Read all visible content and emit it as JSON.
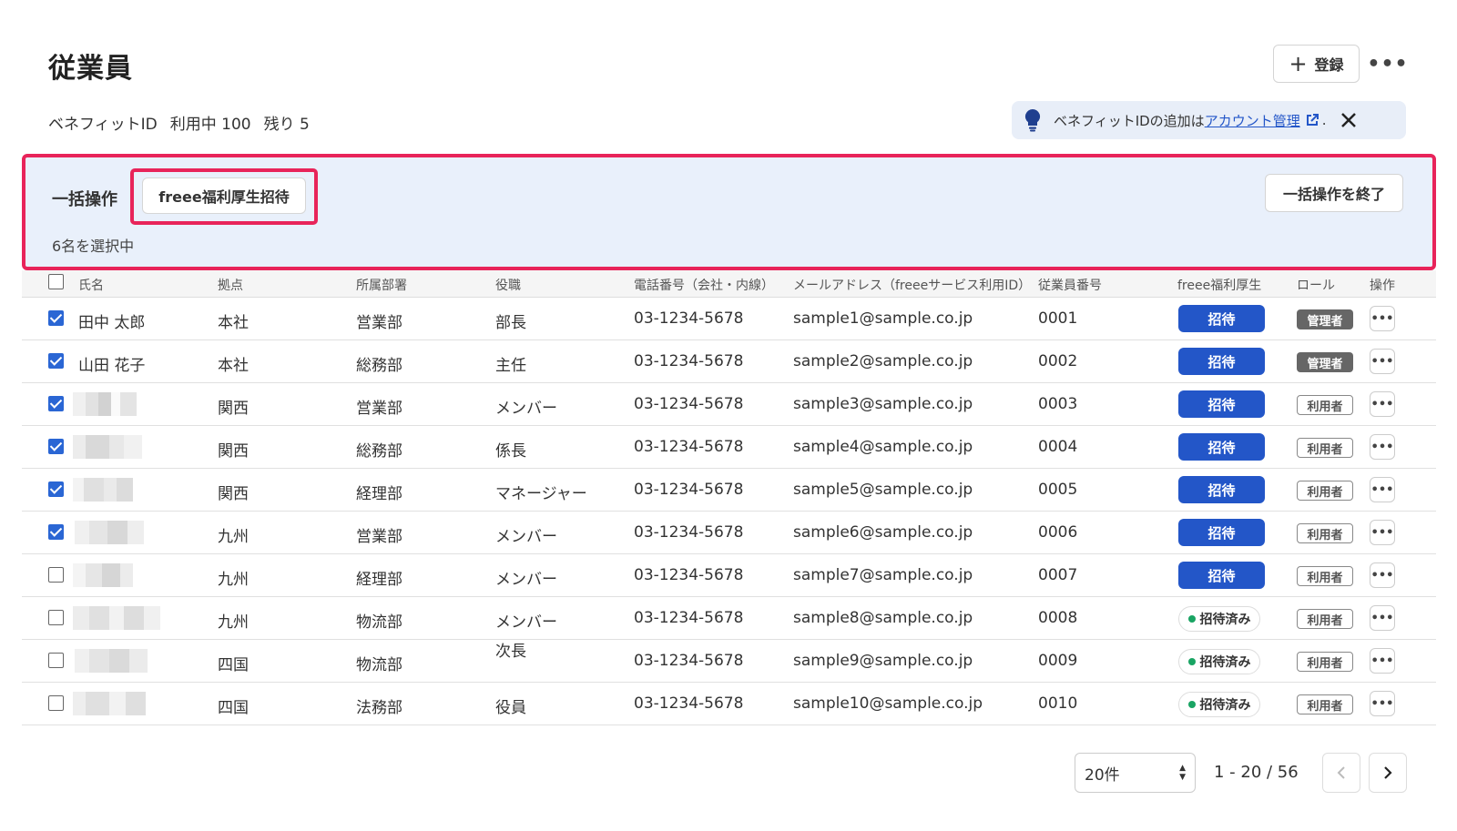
{
  "header": {
    "title": "従業員",
    "register_label": "登録",
    "more_label": "•••"
  },
  "benefit": {
    "label": "ベネフィットID",
    "in_use": "利用中 100",
    "remaining": "残り 5"
  },
  "notice": {
    "text_before": "ベネフィットIDの追加は",
    "link_text": "アカウント管理",
    "text_after": "."
  },
  "bulk": {
    "label": "一括操作",
    "invite_label": "freee福利厚生招待",
    "selected_text": "6名を選択中",
    "end_label": "一括操作を終了"
  },
  "table": {
    "columns": {
      "name": "氏名",
      "location": "拠点",
      "department": "所属部署",
      "position": "役職",
      "phone": "電話番号（会社・内線）",
      "email": "メールアドレス（freeeサービス利用ID）",
      "employee_no": "従業員番号",
      "benefit": "freee福利厚生",
      "role": "ロール",
      "action": "操作"
    },
    "rows": [
      {
        "checked": true,
        "name": "田中 太郎",
        "location": "本社",
        "department": "営業部",
        "position": "部長",
        "phone": "03-1234-5678",
        "email": "sample1@sample.co.jp",
        "employee_no": "0001",
        "status": "招待",
        "role": "管理者"
      },
      {
        "checked": true,
        "name": "山田 花子",
        "location": "本社",
        "department": "総務部",
        "position": "主任",
        "phone": "03-1234-5678",
        "email": "sample2@sample.co.jp",
        "employee_no": "0002",
        "status": "招待",
        "role": "管理者"
      },
      {
        "checked": true,
        "name": "",
        "location": "関西",
        "department": "営業部",
        "position": "メンバー",
        "phone": "03-1234-5678",
        "email": "sample3@sample.co.jp",
        "employee_no": "0003",
        "status": "招待",
        "role": "利用者"
      },
      {
        "checked": true,
        "name": "",
        "location": "関西",
        "department": "総務部",
        "position": "係長",
        "phone": "03-1234-5678",
        "email": "sample4@sample.co.jp",
        "employee_no": "0004",
        "status": "招待",
        "role": "利用者"
      },
      {
        "checked": true,
        "name": "",
        "location": "関西",
        "department": "経理部",
        "position": "マネージャー",
        "phone": "03-1234-5678",
        "email": "sample5@sample.co.jp",
        "employee_no": "0005",
        "status": "招待",
        "role": "利用者"
      },
      {
        "checked": true,
        "name": "",
        "location": "九州",
        "department": "営業部",
        "position": "メンバー",
        "phone": "03-1234-5678",
        "email": "sample6@sample.co.jp",
        "employee_no": "0006",
        "status": "招待",
        "role": "利用者"
      },
      {
        "checked": false,
        "name": "",
        "location": "九州",
        "department": "経理部",
        "position": "メンバー",
        "phone": "03-1234-5678",
        "email": "sample7@sample.co.jp",
        "employee_no": "0007",
        "status": "招待",
        "role": "利用者"
      },
      {
        "checked": false,
        "name": "",
        "location": "九州",
        "department": "物流部",
        "position": "メンバー",
        "phone": "03-1234-5678",
        "email": "sample8@sample.co.jp",
        "employee_no": "0008",
        "status": "招待済み",
        "role": "利用者"
      },
      {
        "checked": false,
        "name": "",
        "location": "四国",
        "department": "物流部",
        "position": "次長",
        "phone": "03-1234-5678",
        "email": "sample9@sample.co.jp",
        "employee_no": "0009",
        "status": "招待済み",
        "role": "利用者"
      },
      {
        "checked": false,
        "name": "",
        "location": "四国",
        "department": "法務部",
        "position": "役員",
        "phone": "03-1234-5678",
        "email": "sample10@sample.co.jp",
        "employee_no": "0010",
        "status": "招待済み",
        "role": "利用者"
      }
    ]
  },
  "pagination": {
    "per_page": "20件",
    "range": "1 - 20  /  56"
  },
  "colors": {
    "accent": "#2356c8",
    "highlight": "#e8245a",
    "bulk_bg": "#e9f0fb",
    "invited_dot": "#19a463"
  }
}
